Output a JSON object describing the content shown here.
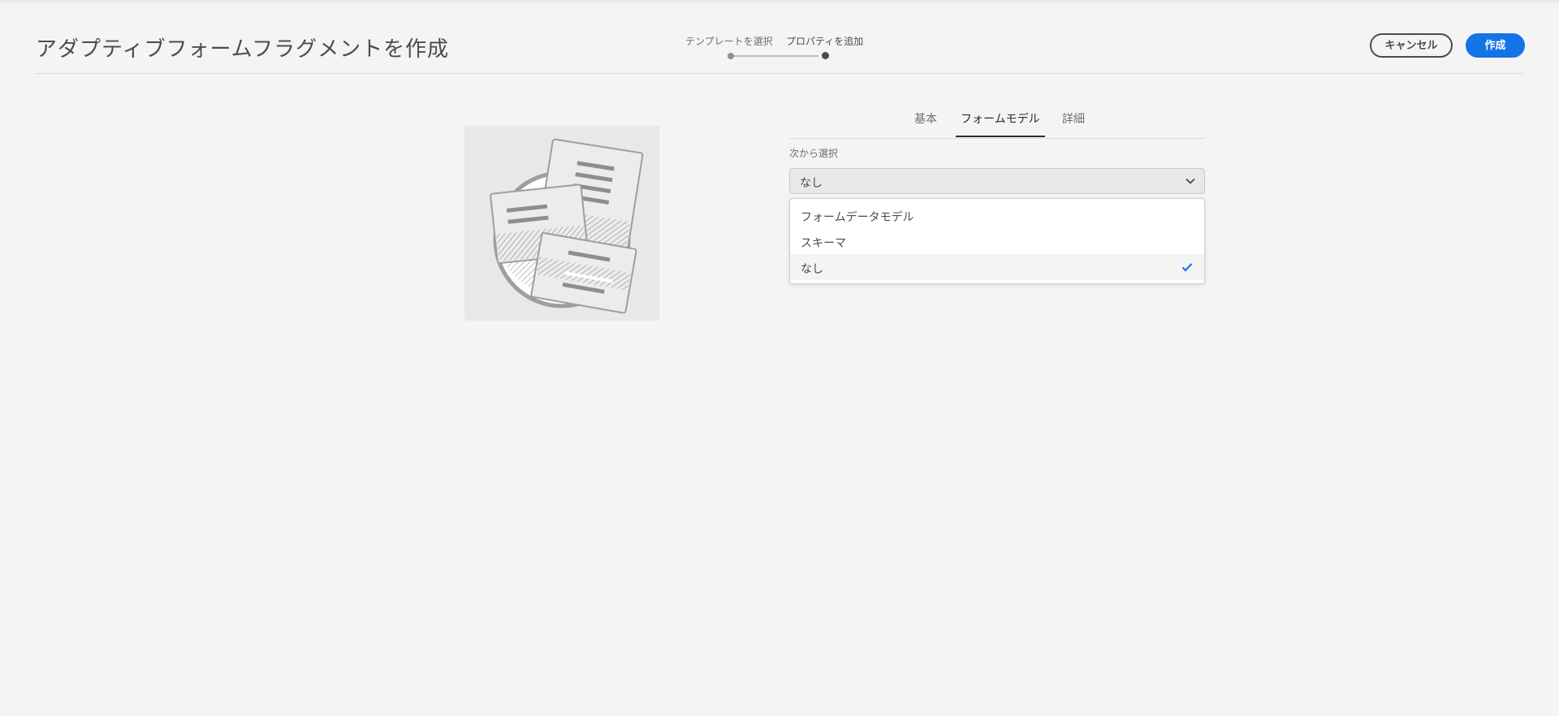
{
  "header": {
    "title": "アダプティブフォームフラグメントを作成",
    "steps": [
      {
        "label": "テンプレートを選択",
        "active": false
      },
      {
        "label": "プロパティを追加",
        "active": true
      }
    ],
    "cancel_label": "キャンセル",
    "create_label": "作成"
  },
  "tabs": [
    {
      "label": "基本",
      "active": false
    },
    {
      "label": "フォームモデル",
      "active": true
    },
    {
      "label": "詳細",
      "active": false
    }
  ],
  "form_model": {
    "select_label": "次から選択",
    "selected_value": "なし",
    "options": [
      {
        "label": "フォームデータモデル",
        "selected": false
      },
      {
        "label": "スキーマ",
        "selected": false
      },
      {
        "label": "なし",
        "selected": true
      }
    ]
  },
  "thumbnail": {
    "icon": "form-fragment-illustration-icon"
  },
  "colors": {
    "accent": "#1473e6",
    "background": "#f4f4f4",
    "text": "#4b4b4b"
  }
}
